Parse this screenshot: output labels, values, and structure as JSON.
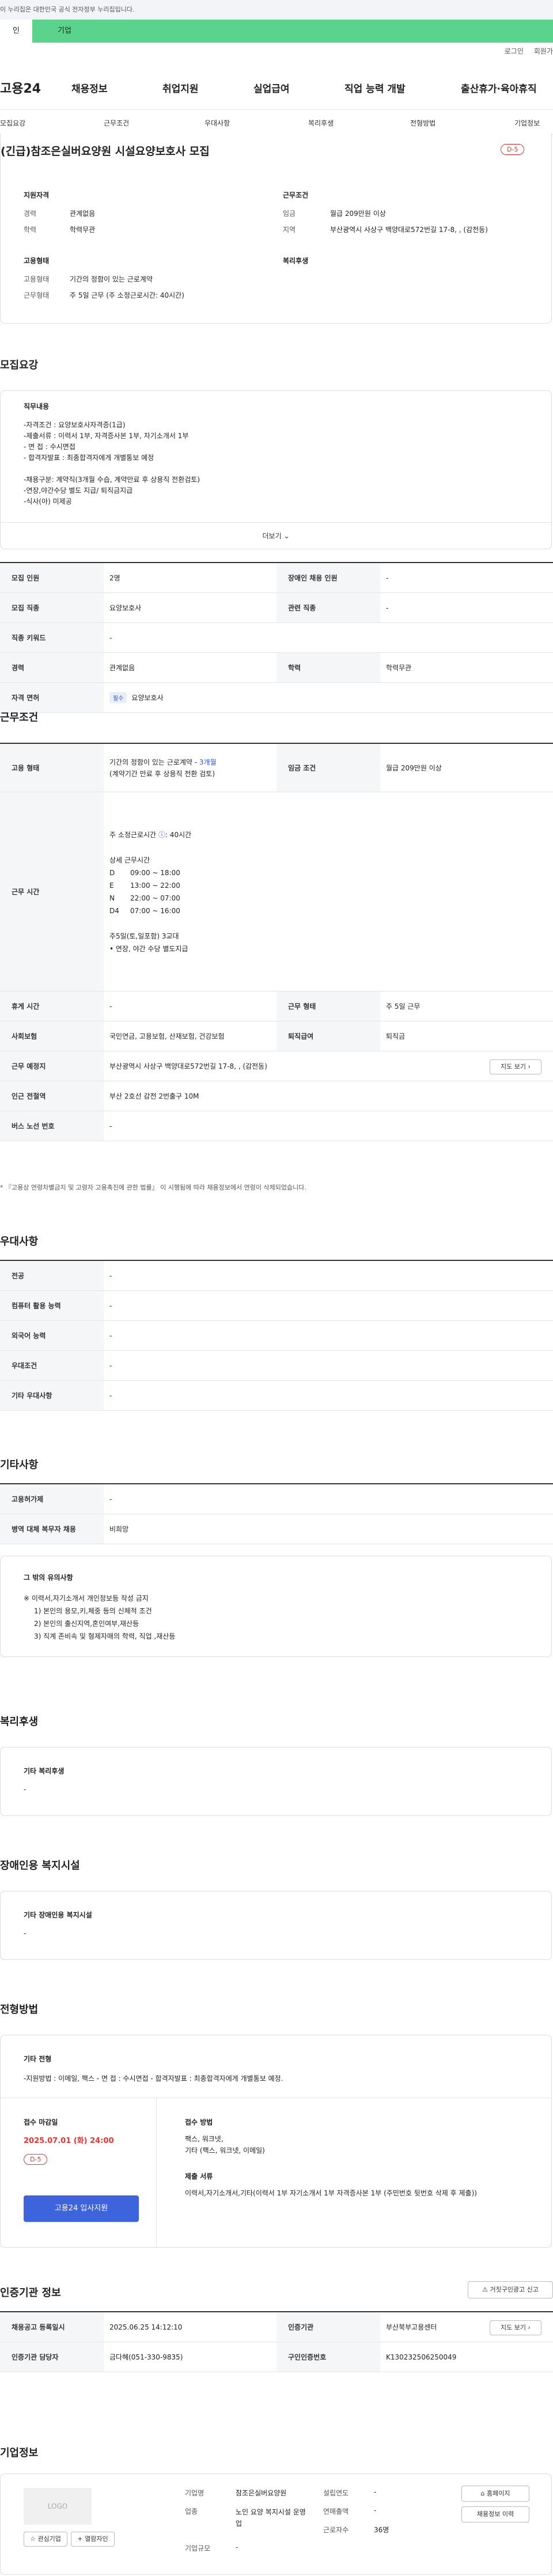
{
  "gov_notice": "이 누리집은 대한민국 공식 전자정부 누리집입니다.",
  "site_tabs": {
    "tab1": "인",
    "tab2": "기업"
  },
  "top_links": {
    "login": "로그인",
    "join": "회원가"
  },
  "logo": "고용24",
  "gnb": [
    "채용정보",
    "취업지원",
    "실업급여",
    "직업 능력 개발",
    "출산휴가·육아휴직"
  ],
  "subnav": [
    "모집요강",
    "근무조건",
    "우대사항",
    "복리후생",
    "전형방법",
    "기업정보"
  ],
  "summary": {
    "title": "(긴급)참조은실버요양원 시설요양보호사 모집",
    "dday": "D-5",
    "applicant_head": "지원자격",
    "career_label": "경력",
    "career": "관계없음",
    "edu_label": "학력",
    "edu": "학력무관",
    "work_head": "근무조건",
    "wage_label": "임금",
    "wage": "월급 209만원 이상",
    "area_label": "지역",
    "area": "부산광역시 사상구 백양대로572번길 17-8, , (감전동)",
    "emp_head": "고용형태",
    "emp_label": "고용형태",
    "emp": "기간의 정함이 있는 근로계약",
    "hours_label": "근무형태",
    "hours": "주 5일 근무 (주 소정근로시간: 40시간)",
    "welfare_head": "복리후생"
  },
  "recruit": {
    "section_title": "모집요강",
    "duty_title": "직무내용",
    "duty_lines": [
      "-자격조건 : 요양보호사자격증(1급)",
      "-제출서류 : 이력서 1부, 자격증사본 1부, 자기소개서 1부",
      "- 면 접 : 수시면접",
      "- 합격자발표 : 최종합격자에게 개별통보 예정",
      "",
      "-채용구분: 계약직(3개월 수습, 계약만료 후 상용직 전환검토)",
      "-연장,야간수당 별도 지급/ 퇴직금지급",
      "-식사(아) 미제공"
    ],
    "more": "더보기",
    "rows": [
      {
        "k1": "모집 인원",
        "v1": "2명",
        "k2": "장애인 채용 인원",
        "v2": "-"
      },
      {
        "k1": "모집 직종",
        "v1": "요양보호사",
        "k2": "관련 직종",
        "v2": "-"
      },
      {
        "k1": "직종 키워드",
        "v1": "-",
        "k2": "",
        "v2": ""
      },
      {
        "k1": "경력",
        "v1": "관계없음",
        "k2": "학력",
        "v2": "학력무관"
      },
      {
        "k1": "자격 면허",
        "v1": "요양보호사",
        "k2": "",
        "v2": ""
      }
    ],
    "license_tag": "필수"
  },
  "cond": {
    "section_title": "근무조건",
    "emp_label": "고용 형태",
    "emp_main": "기간의 정함이 있는 근로계약 - ",
    "emp_period": "3개월",
    "emp_sub": "(계약기간 만료 후 상용직 전환 검토)",
    "wage_label": "임금 조건",
    "wage": "월급 209만원 이상",
    "time_label": "근무 시간",
    "time_weekly": "주 소정근로시간",
    "time_weekly_val": ": 40시간",
    "time_detail_head": "상세 근무시간",
    "shifts": [
      {
        "code": "D",
        "time": "09:00 ~ 18:00"
      },
      {
        "code": "E",
        "time": "13:00 ~ 22:00"
      },
      {
        "code": "N",
        "time": "22:00 ~ 07:00"
      },
      {
        "code": "D4",
        "time": "07:00 ~ 16:00"
      }
    ],
    "time_note1": "주5일(토,일포함) 3교대",
    "time_note2": "• 연장, 야간 수당 별도지급",
    "rest_label": "휴게 시간",
    "rest": "-",
    "form_label": "근무 형태",
    "form": "주 5일 근무",
    "ins_label": "사회보험",
    "ins": "국민연금, 고용보험, 산재보험, 건강보험",
    "sev_label": "퇴직급여",
    "sev": "퇴직금",
    "place_label": "근무 예정지",
    "place": "부산광역시 사상구 백양대로572번길 17-8, , (감전동)",
    "map_btn": "지도 보기",
    "station_label": "인근 전철역",
    "station": "부산 2호선 감전 2번출구 10M",
    "bus_label": "버스 노선 번호",
    "bus": "-",
    "footnote": "* 『고용상 연령차별금지 및 고령자 고용촉진에 관한 법률』 이 시행됨에 따라 채용정보에서 연령이 삭제되었습니다."
  },
  "pref": {
    "section_title": "우대사항",
    "rows": [
      {
        "k": "전공",
        "v": "-"
      },
      {
        "k": "컴퓨터 활용 능력",
        "v": "-"
      },
      {
        "k": "외국어 능력",
        "v": "-"
      },
      {
        "k": "우대조건",
        "v": "-"
      },
      {
        "k": "기타 우대사항",
        "v": "-"
      }
    ]
  },
  "etc": {
    "section_title": "기타사항",
    "rows": [
      {
        "k": "고용허가제",
        "v": "-"
      },
      {
        "k": "병역 대체 복무자 채용",
        "v": "비희망"
      }
    ],
    "box_title": "그 밖의 유의사항",
    "box_lines": [
      "※ 이력서,자기소개서 개인정보등 작성 금지",
      "1) 본인의 용모,키,체중 등의 신체적 조건",
      "2) 본인의 출신지역,혼인여부,재산등",
      "3) 직계 존비속 및 형제자매의 학력, 직업 ,재산등"
    ]
  },
  "welfare": {
    "section_title": "복리후생",
    "box_title": "기타 복리후생",
    "box_value": "-"
  },
  "disabled": {
    "section_title": "장애인용 복지시설",
    "box_title": "기타 장애인용 복지시설",
    "box_value": "-"
  },
  "process": {
    "section_title": "전형방법",
    "box_title": "기타 전형",
    "box_value": "-지원방법 : 이메일, 팩스 - 면 접 : 수시면접 - 합격자발표 : 최종합격자에게 개별통보 예정.",
    "deadline_label": "접수 마감일",
    "deadline": "2025.07.01 (화) 24:00",
    "dday": "D-5",
    "apply_btn": "고용24 입사지원",
    "method_label": "접수 방법",
    "methods": [
      "팩스, 워크넷,",
      "기타 (팩스, 워크넷, 이메일)"
    ],
    "docs_label": "제출 서류",
    "docs": "이력서,자기소개서,기타(이력서 1부 자기소개서 1부 자격증사본 1부 (주민번호 뒷번호 삭제 후 제출))"
  },
  "agency": {
    "section_title": "인증기관 정보",
    "report_btn": "거짓구인광고 신고",
    "rows": [
      {
        "k1": "채용공고 등록일시",
        "v1": "2025.06.25 14:12:10",
        "k2": "인증기관",
        "v2": "부산북부고용센터",
        "btn": "지도 보기"
      },
      {
        "k1": "인증기관 담당자",
        "v1": "금다혜(051-330-9835)",
        "k2": "구인인증번호",
        "v2": "K130232506250049"
      }
    ]
  },
  "company": {
    "section_title": "기업정보",
    "logo_text": "LOGO",
    "fav_btn": "관심기업",
    "review_btn": "열람자인",
    "name_label": "기업명",
    "name": "참조은실버요양원",
    "industry_label": "업종",
    "industry": "노인 요양 복지시설 운영업",
    "size_label": "기업규모",
    "size": "-",
    "year_label": "설립연도",
    "year": "-",
    "sales_label": "연매출액",
    "sales": "-",
    "emp_label": "근로자수",
    "emp": "36명",
    "home_btn": "홈페이지",
    "hist_btn": "채용정보 이력"
  }
}
